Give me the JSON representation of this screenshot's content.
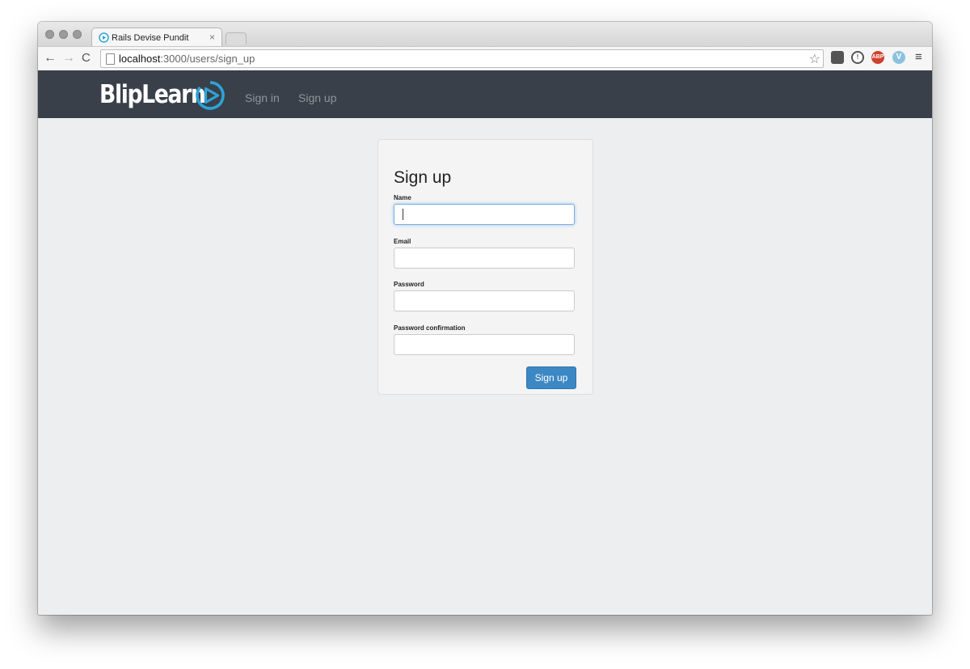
{
  "browser": {
    "tab_title": "Rails Devise Pundit",
    "tab_close": "×",
    "url_host": "localhost",
    "url_rest": ":3000/users/sign_up",
    "back_glyph": "←",
    "forward_glyph": "→",
    "reload_glyph": "C",
    "star_glyph": "☆",
    "extensions": {
      "pocket": "",
      "onepassword": "!",
      "abp": "ABP",
      "vimeo": "V"
    },
    "menu_glyph": "≡"
  },
  "navbar": {
    "brand": "BlipLearn",
    "links": [
      {
        "label": "Sign in"
      },
      {
        "label": "Sign up"
      }
    ]
  },
  "form": {
    "title": "Sign up",
    "fields": [
      {
        "label": "Name",
        "value": ""
      },
      {
        "label": "Email",
        "value": ""
      },
      {
        "label": "Password",
        "value": ""
      },
      {
        "label": "Password confirmation",
        "value": ""
      }
    ],
    "submit_label": "Sign up"
  },
  "colors": {
    "navbar_bg": "#394049",
    "nav_link": "#8f959c",
    "brand_accent": "#2ea3d8",
    "button_primary": "#3c88c5",
    "page_bg": "#eceef0"
  },
  "icons": [
    "play-logo-icon",
    "back-arrow-icon",
    "forward-arrow-icon",
    "reload-icon",
    "page-icon",
    "star-icon",
    "pocket-icon",
    "onepassword-icon",
    "abp-icon",
    "vimeo-icon",
    "menu-icon"
  ]
}
